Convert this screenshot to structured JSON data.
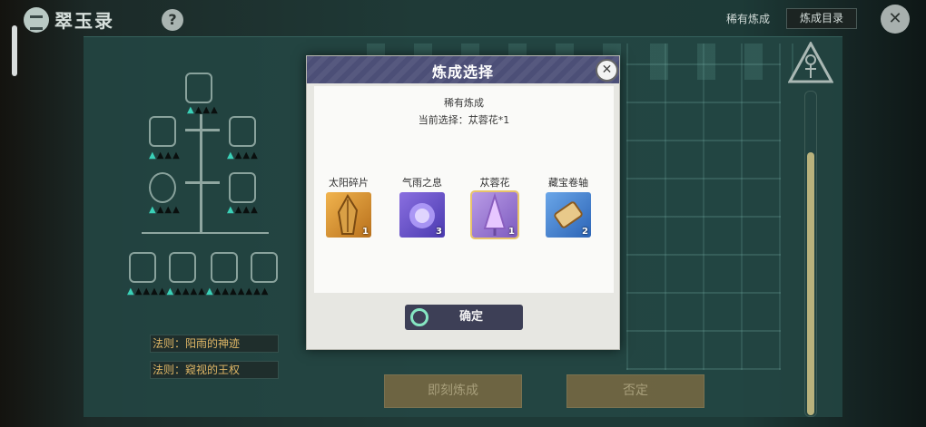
{
  "app": {
    "title": "翠玉录",
    "help": "?"
  },
  "top_right": {
    "rare_label": "稀有炼成",
    "catalog_button": "炼成目录",
    "close": "✕"
  },
  "rules": [
    "法则：阳雨的神迹",
    "法则：窥视的王权"
  ],
  "bottom_buttons": {
    "engrave": "即刻炼成",
    "deny": "否定"
  },
  "modal": {
    "title": "炼成选择",
    "close": "✕",
    "subtitle": "稀有炼成",
    "current_selection": "当前选择：苁蓉花*1",
    "items": [
      {
        "name": "太阳碎片",
        "count": "1",
        "selected": false
      },
      {
        "name": "气雨之息",
        "count": "3",
        "selected": false
      },
      {
        "name": "苁蓉花",
        "count": "1",
        "selected": true
      },
      {
        "name": "藏宝卷轴",
        "count": "2",
        "selected": false
      }
    ],
    "confirm": "确定"
  }
}
